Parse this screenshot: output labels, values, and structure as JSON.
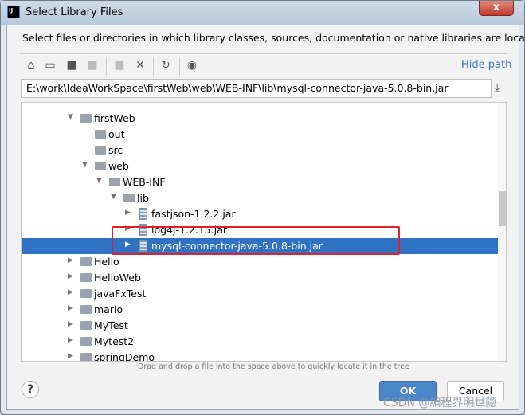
{
  "window": {
    "title": "Select Library Files",
    "close_label": "x"
  },
  "description": "Select files or directories in which library classes, sources, documentation or native libraries are located",
  "toolbar": {
    "icons": [
      "home-icon",
      "desktop-icon",
      "project-folder-icon",
      "module-folder-icon",
      "new-folder-icon",
      "delete-icon",
      "refresh-icon",
      "show-hidden-icon"
    ],
    "hide_path": "Hide path"
  },
  "path_value": "E:\\work\\IdeaWorkSpace\\firstWeb\\web\\WEB-INF\\lib\\mysql-connector-java-5.0.8-bin.jar",
  "tree": [
    {
      "label": "firstWeb",
      "level": 0,
      "type": "folder",
      "expanded": true
    },
    {
      "label": "out",
      "level": 1,
      "type": "folder",
      "leaf": true
    },
    {
      "label": "src",
      "level": 1,
      "type": "folder",
      "leaf": true
    },
    {
      "label": "web",
      "level": 1,
      "type": "folder",
      "expanded": true
    },
    {
      "label": "WEB-INF",
      "level": 2,
      "type": "folder",
      "expanded": true
    },
    {
      "label": "lib",
      "level": 3,
      "type": "folder",
      "expanded": true
    },
    {
      "label": "fastjson-1.2.2.jar",
      "level": 4,
      "type": "jar"
    },
    {
      "label": "log4j-1.2.15.jar",
      "level": 4,
      "type": "jar"
    },
    {
      "label": "mysql-connector-java-5.0.8-bin.jar",
      "level": 4,
      "type": "jar",
      "selected": true
    },
    {
      "label": "Hello",
      "level": 0,
      "type": "folder"
    },
    {
      "label": "HelloWeb",
      "level": 0,
      "type": "folder"
    },
    {
      "label": "javaFxTest",
      "level": 0,
      "type": "folder"
    },
    {
      "label": "mario",
      "level": 0,
      "type": "folder"
    },
    {
      "label": "MyTest",
      "level": 0,
      "type": "folder"
    },
    {
      "label": "Mytest2",
      "level": 0,
      "type": "folder"
    },
    {
      "label": "springDemo",
      "level": 0,
      "type": "folder"
    }
  ],
  "hint": "Drag and drop a file into the space above to quickly locate it in the tree",
  "buttons": {
    "help": "?",
    "ok": "OK",
    "cancel": "Cancel"
  },
  "watermark": "CSDN @编程界明世隐",
  "colors": {
    "selection": "#2f72c4",
    "highlight_box": "#e0202a",
    "accent": "#3a7bd5"
  }
}
